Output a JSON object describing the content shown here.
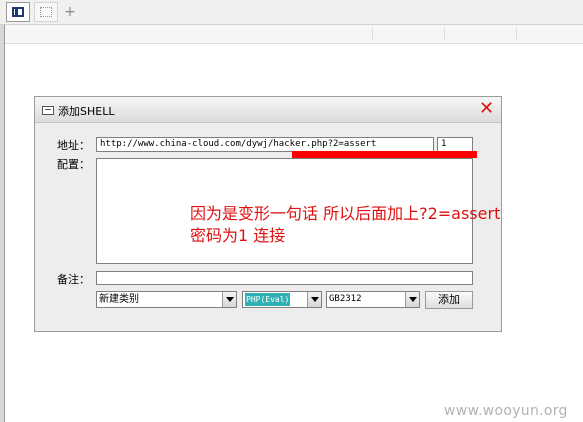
{
  "tabs": {
    "add_label": "+"
  },
  "dialog": {
    "title": "添加SHELL",
    "close_label": "✕",
    "address_label": "地址：",
    "address_value": "http://www.china-cloud.com/dywj/hacker.php?2=assert",
    "password_value": "1",
    "config_label": "配置：",
    "config_value": "",
    "note_label": "备注：",
    "note_value": "",
    "category_value": "新建类别",
    "type_value": "PHP(Eval)",
    "encoding_value": "GB2312",
    "add_label": "添加"
  },
  "annotation": {
    "line1": "因为是变形一句话 所以后面加上?2=assert",
    "line2": "密码为1  连接",
    "color": "#e01010",
    "marker_color": "#ff0000"
  },
  "watermark": "www.wooyun.org"
}
